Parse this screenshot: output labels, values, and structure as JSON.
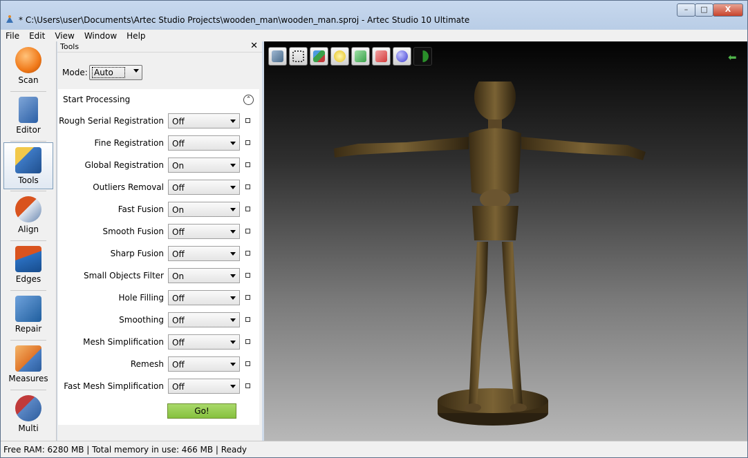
{
  "window": {
    "title": "* C:\\Users\\user\\Documents\\Artec Studio Projects\\wooden_man\\wooden_man.sproj - Artec Studio 10 Ultimate",
    "minimize": "–",
    "maximize": "□",
    "close": "X"
  },
  "menu": [
    "File",
    "Edit",
    "View",
    "Window",
    "Help"
  ],
  "sidebar": [
    {
      "label": "Scan",
      "icon": "scan-icon",
      "color": "#f07a1a"
    },
    {
      "label": "Editor",
      "icon": "editor-icon",
      "color": "#2b5fa6"
    },
    {
      "label": "Tools",
      "icon": "tools-icon",
      "color": "#3d79c4"
    },
    {
      "label": "Align",
      "icon": "align-icon",
      "color": "#d9531e"
    },
    {
      "label": "Edges",
      "icon": "edges-icon",
      "color": "#2a6fc0"
    },
    {
      "label": "Repair",
      "icon": "repair-icon",
      "color": "#1f5e9e"
    },
    {
      "label": "Measures",
      "icon": "measures-icon",
      "color": "#e0762a"
    },
    {
      "label": "Multi",
      "icon": "multi-icon",
      "color": "#c03a3a"
    }
  ],
  "tools_panel": {
    "title": "Tools",
    "close": "✕",
    "mode_label": "Mode:",
    "mode_value": "Auto",
    "section_title": "Start Processing",
    "collapse_symbol": "⌃",
    "rows": [
      {
        "label": "Rough Serial Registration",
        "value": "Off"
      },
      {
        "label": "Fine Registration",
        "value": "Off"
      },
      {
        "label": "Global Registration",
        "value": "On"
      },
      {
        "label": "Outliers Removal",
        "value": "Off"
      },
      {
        "label": "Fast Fusion",
        "value": "On"
      },
      {
        "label": "Smooth Fusion",
        "value": "Off"
      },
      {
        "label": "Sharp Fusion",
        "value": "Off"
      },
      {
        "label": "Small Objects Filter",
        "value": "On"
      },
      {
        "label": "Hole Filling",
        "value": "Off"
      },
      {
        "label": "Smoothing",
        "value": "Off"
      },
      {
        "label": "Mesh Simplification",
        "value": "Off"
      },
      {
        "label": "Remesh",
        "value": "Off"
      },
      {
        "label": "Fast Mesh Simplification",
        "value": "Off"
      }
    ],
    "go_label": "Go!"
  },
  "viewport_toolbar": [
    {
      "icon": "home-view-icon",
      "color": "#4a6b8a"
    },
    {
      "icon": "fit-view-icon",
      "color": "#3a3a3a"
    },
    {
      "icon": "axes-icon",
      "color": "#c23b3b"
    },
    {
      "icon": "light-bulb-icon",
      "color": "#e6c21e"
    },
    {
      "icon": "texture-mode-icon",
      "color": "#3aa14a"
    },
    {
      "icon": "solid-mode-icon",
      "color": "#d23a3a"
    },
    {
      "icon": "sphere-mode-icon",
      "color": "#3d3dd0"
    },
    {
      "icon": "light-toggle-icon",
      "color": "#2a8f2a"
    }
  ],
  "status": {
    "text": "Free RAM: 6280 MB  |  Total memory in use: 466 MB  |    Ready"
  }
}
